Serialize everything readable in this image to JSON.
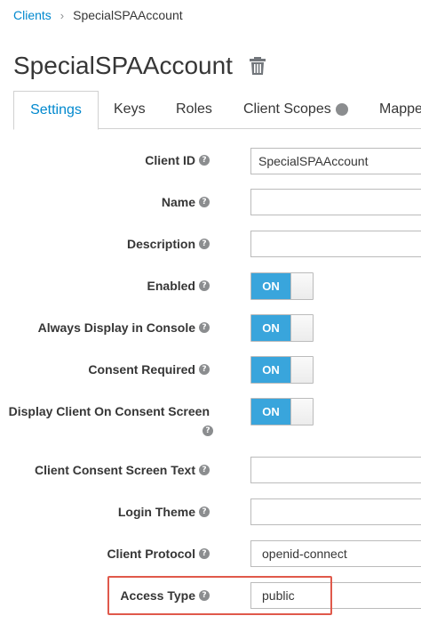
{
  "breadcrumb": {
    "parent": "Clients",
    "separator": "›",
    "current": "SpecialSPAAccount"
  },
  "page": {
    "title": "SpecialSPAAccount"
  },
  "tabs": [
    "Settings",
    "Keys",
    "Roles",
    "Client Scopes",
    "Mappe"
  ],
  "form": {
    "client_id": {
      "label": "Client ID",
      "value": "SpecialSPAAccount"
    },
    "name": {
      "label": "Name",
      "value": ""
    },
    "description": {
      "label": "Description",
      "value": ""
    },
    "enabled": {
      "label": "Enabled",
      "state": "ON"
    },
    "always_display": {
      "label": "Always Display in Console",
      "state": "ON"
    },
    "consent_required": {
      "label": "Consent Required",
      "state": "ON"
    },
    "display_consent": {
      "label": "Display Client On Consent Screen",
      "state": "ON"
    },
    "consent_text": {
      "label": "Client Consent Screen Text",
      "value": ""
    },
    "login_theme": {
      "label": "Login Theme",
      "value": ""
    },
    "client_protocol": {
      "label": "Client Protocol",
      "value": "openid-connect"
    },
    "access_type": {
      "label": "Access Type",
      "value": "public"
    }
  },
  "help_glyph": "?",
  "colors": {
    "link": "#0088ce",
    "toggle_on": "#39a5dc",
    "highlight": "#e0594b"
  }
}
